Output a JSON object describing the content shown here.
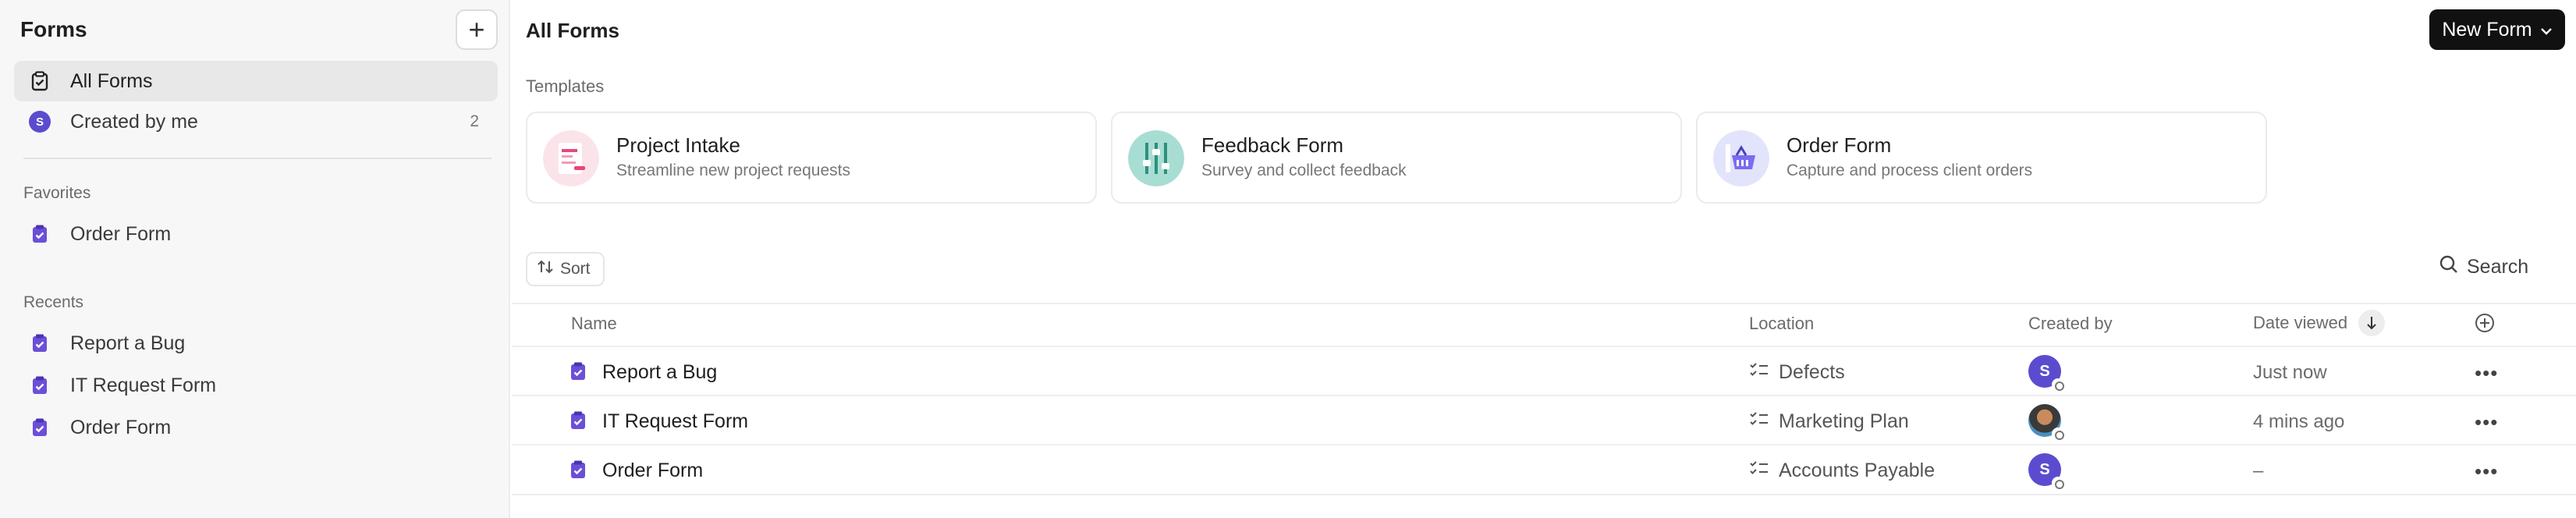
{
  "sidebar": {
    "title": "Forms",
    "nav": [
      {
        "label": "All Forms",
        "count": ""
      },
      {
        "label": "Created by me",
        "count": "2",
        "avatar_initial": "S"
      }
    ],
    "favorites_label": "Favorites",
    "favorites": [
      {
        "label": "Order Form"
      }
    ],
    "recents_label": "Recents",
    "recents": [
      {
        "label": "Report a Bug"
      },
      {
        "label": "IT Request Form"
      },
      {
        "label": "Order Form"
      }
    ]
  },
  "main": {
    "title": "All Forms",
    "new_form_label": "New Form",
    "templates_label": "Templates",
    "templates": [
      {
        "title": "Project Intake",
        "subtitle": "Streamline new project requests"
      },
      {
        "title": "Feedback Form",
        "subtitle": "Survey and collect feedback"
      },
      {
        "title": "Order Form",
        "subtitle": "Capture and process client orders"
      }
    ],
    "sort_label": "Sort",
    "search_label": "Search",
    "columns": {
      "name": "Name",
      "location": "Location",
      "created_by": "Created by",
      "date_viewed": "Date viewed"
    },
    "rows": [
      {
        "name": "Report a Bug",
        "location": "Defects",
        "creator_initial": "S",
        "date_viewed": "Just now"
      },
      {
        "name": "IT Request Form",
        "location": "Marketing Plan",
        "creator_initial": "",
        "date_viewed": "4 mins ago"
      },
      {
        "name": "Order Form",
        "location": "Accounts Payable",
        "creator_initial": "S",
        "date_viewed": "–"
      }
    ]
  },
  "colors": {
    "accent": "#5b4ccf",
    "form_icon": "#6b4fd8",
    "button_dark": "#111111"
  }
}
